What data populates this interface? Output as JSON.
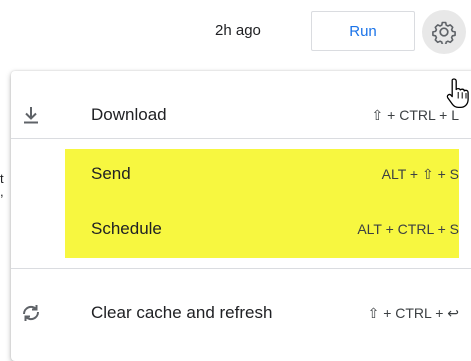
{
  "toolbar": {
    "time_ago": "2h ago",
    "run_label": "Run"
  },
  "background_fragments": {
    "fragment_1": "t",
    "fragment_2": ","
  },
  "menu": {
    "items": [
      {
        "label": "Download",
        "shortcut": "⇧ + CTRL + L",
        "icon": "download-icon"
      },
      {
        "label": "Send",
        "shortcut": "ALT + ⇧ + S",
        "icon": ""
      },
      {
        "label": "Schedule",
        "shortcut": "ALT + CTRL + S",
        "icon": ""
      },
      {
        "label": "Clear cache and refresh",
        "shortcut": "⇧ + CTRL + ↩",
        "icon": "refresh-icon"
      }
    ],
    "highlight_color": "#f7f740"
  },
  "colors": {
    "accent": "#1a73e8",
    "divider": "#dadce0"
  }
}
